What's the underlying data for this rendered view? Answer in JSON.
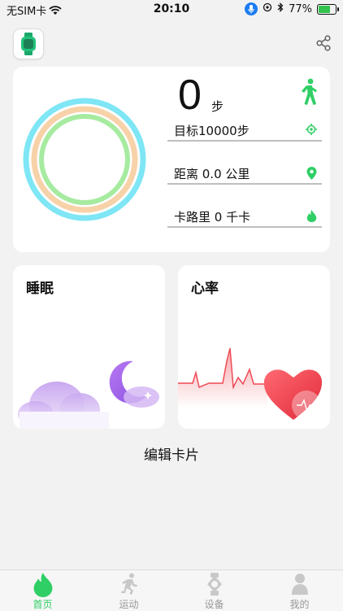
{
  "status_bar": {
    "carrier": "无SIM卡",
    "time": "20:10",
    "battery": "77%",
    "battery_level": 0.77
  },
  "activity": {
    "steps_value": "0",
    "steps_unit": "步",
    "goal": "目标10000步",
    "distance": "距离 0.0 公里",
    "calories": "卡路里 0 千卡"
  },
  "cards": {
    "sleep_title": "睡眠",
    "heart_title": "心率",
    "edit_label": "编辑卡片"
  },
  "tabs": [
    {
      "label": "首页",
      "icon": "flame-icon",
      "active": true
    },
    {
      "label": "运动",
      "icon": "runner-icon",
      "active": false
    },
    {
      "label": "设备",
      "icon": "watch-icon",
      "active": false
    },
    {
      "label": "我的",
      "icon": "person-icon",
      "active": false
    }
  ],
  "colors": {
    "accent": "#2fcf65",
    "ring_outer": "#7ee6f5",
    "ring_middle": "#f7d2a9",
    "ring_inner": "#a6eba0"
  }
}
